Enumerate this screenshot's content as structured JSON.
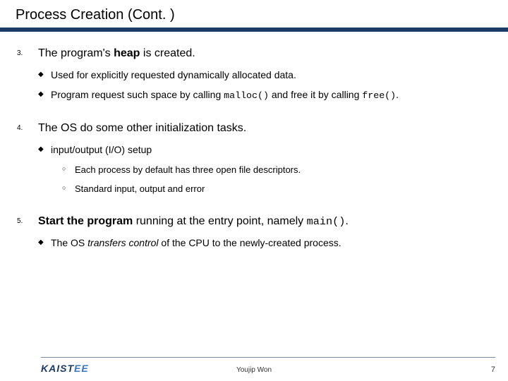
{
  "title": "Process Creation (Cont. )",
  "items": [
    {
      "num": "3.",
      "lead_pre": "The program's ",
      "lead_bold": "heap",
      "lead_post": " is created.",
      "subs": [
        {
          "text": "Used for explicitly requested dynamically allocated data."
        },
        {
          "pre": "Program request such space by calling ",
          "code1": "malloc()",
          "mid": " and free it by calling ",
          "code2": "free()",
          "post": "."
        }
      ]
    },
    {
      "num": "4.",
      "lead_plain": "The OS do some other initialization tasks.",
      "subs": [
        {
          "text": "input/output (I/O) setup",
          "subs2": [
            {
              "text": "Each process by default has three open file descriptors."
            },
            {
              "text": "Standard input, output and error"
            }
          ]
        }
      ]
    },
    {
      "num": "5.",
      "lead_bold_pre": "Start the program",
      "lead_mid": " running at the entry point, namely ",
      "lead_code": "main()",
      "lead_post2": ".",
      "subs": [
        {
          "pre2": "The OS ",
          "italic": "transfers control",
          "post2": " of the CPU to the newly-created process."
        }
      ]
    }
  ],
  "footer": {
    "logo_main": "KAIST",
    "logo_suffix": "EE",
    "author": "Youjip Won",
    "page": "7"
  }
}
